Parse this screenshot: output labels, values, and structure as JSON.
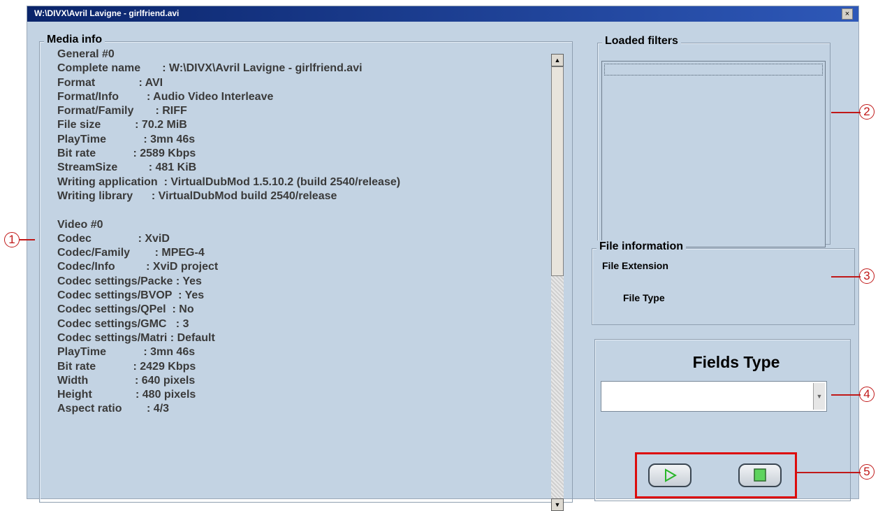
{
  "window": {
    "title": "W:\\DIVX\\Avril Lavigne - girlfriend.avi",
    "close_label": "×"
  },
  "media_info": {
    "legend": "Media info",
    "lines": [
      "General #0",
      "Complete name       : W:\\DIVX\\Avril Lavigne - girlfriend.avi",
      "Format              : AVI",
      "Format/Info         : Audio Video Interleave",
      "Format/Family       : RIFF",
      "File size           : 70.2 MiB",
      "PlayTime            : 3mn 46s",
      "Bit rate            : 2589 Kbps",
      "StreamSize          : 481 KiB",
      "Writing application  : VirtualDubMod 1.5.10.2 (build 2540/release)",
      "Writing library      : VirtualDubMod build 2540/release",
      "",
      "Video #0",
      "Codec               : XviD",
      "Codec/Family        : MPEG-4",
      "Codec/Info          : XviD project",
      "Codec settings/Packe : Yes",
      "Codec settings/BVOP  : Yes",
      "Codec settings/QPel  : No",
      "Codec settings/GMC   : 3",
      "Codec settings/Matri : Default",
      "PlayTime            : 3mn 46s",
      "Bit rate            : 2429 Kbps",
      "Width               : 640 pixels",
      "Height              : 480 pixels",
      "Aspect ratio        : 4/3"
    ]
  },
  "scrollbar": {
    "up_icon": "▲",
    "down_icon": "▼"
  },
  "loaded_filters": {
    "legend": "Loaded filters"
  },
  "file_information": {
    "legend": "File information",
    "extension_label": "File Extension",
    "type_label": "File Type"
  },
  "fields_type": {
    "title": "Fields Type",
    "selected_value": "",
    "dropdown_icon": "▼"
  },
  "controls": {
    "play_icon": "play-icon",
    "stop_icon": "stop-icon"
  },
  "callouts": [
    "1",
    "2",
    "3",
    "4",
    "5"
  ],
  "colors": {
    "annotation": "#c01818",
    "window_bg": "#c3d3e3",
    "titlebar": "#0a246a"
  }
}
